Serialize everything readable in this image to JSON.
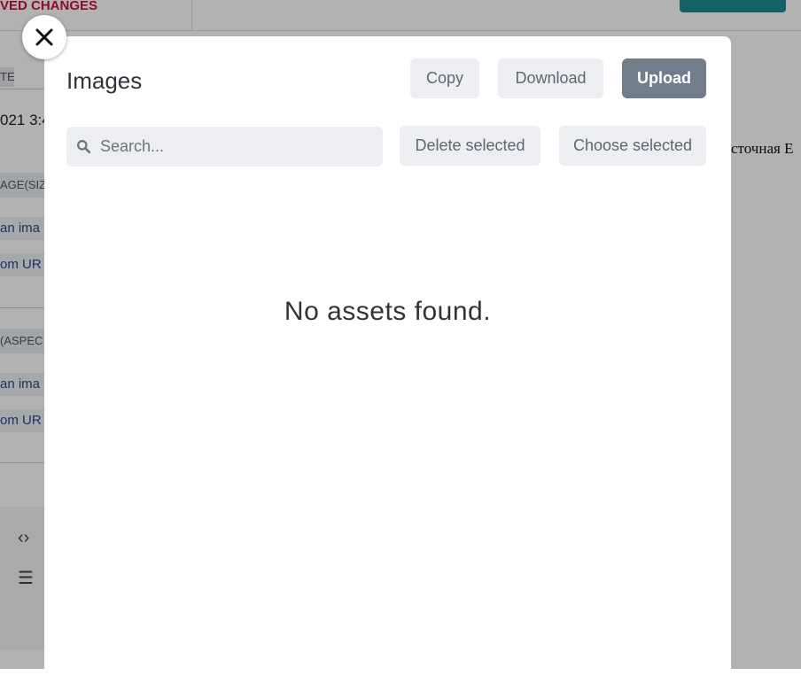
{
  "background": {
    "unsaved_text": "VED CHANGES",
    "tab_chip": "TE",
    "date_text": "021 3:4",
    "section1_tag": "AGE(SIZ",
    "section1_links": [
      "an ima",
      "om UR"
    ],
    "section2_tag": "(ASPEC",
    "section2_links": [
      "an ima",
      "om UR"
    ],
    "right_text": "сточная Е",
    "icons": [
      "code-icon",
      "list-icon"
    ]
  },
  "modal": {
    "title": "Images",
    "buttons": {
      "copy": "Copy",
      "download": "Download",
      "upload": "Upload",
      "delete_selected": "Delete selected",
      "choose_selected": "Choose selected"
    },
    "search": {
      "placeholder": "Search...",
      "value": ""
    },
    "empty_message": "No assets found.",
    "close_icon": "close-icon"
  },
  "colors": {
    "upload_button": "#727d8b",
    "button_bg": "#eceef2",
    "unsaved_red": "#d0103a",
    "teal": "#1f8a93"
  }
}
